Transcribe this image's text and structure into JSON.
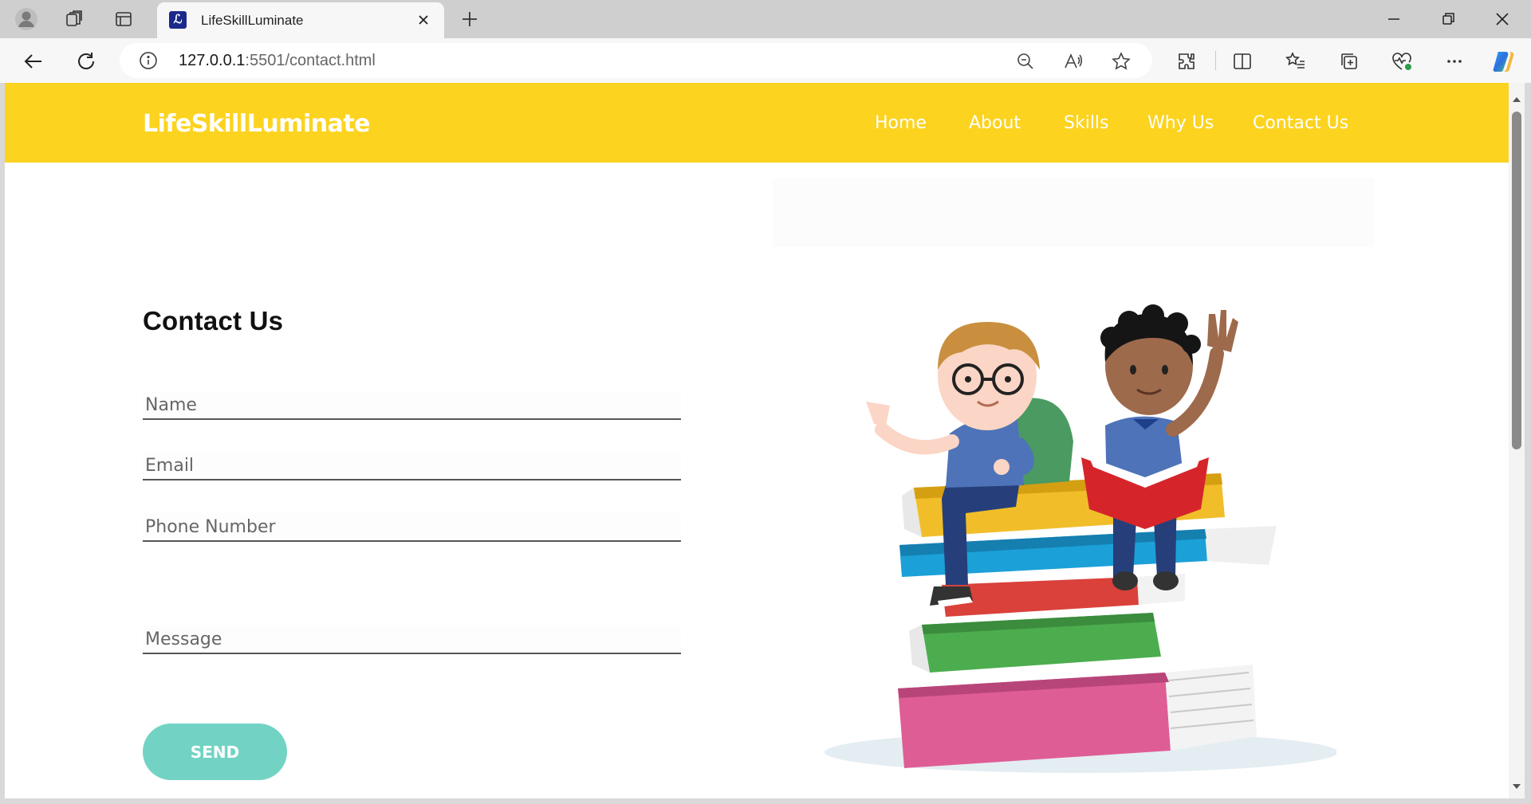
{
  "browser": {
    "tab_title": "LifeSkillLuminate",
    "url_host": "127.0.0.1",
    "url_rest": ":5501/contact.html"
  },
  "site": {
    "logo": "LifeSkillLuminate",
    "nav": [
      "Home",
      "About",
      "Skills",
      "Why Us",
      "Contact Us"
    ],
    "brand_color": "#fcd31f"
  },
  "contact": {
    "title": "Contact Us",
    "name_placeholder": "Name",
    "email_placeholder": "Email",
    "phone_placeholder": "Phone Number",
    "message_placeholder": "Message",
    "send_label": "SEND",
    "button_color": "#72d3c4"
  },
  "illustration": {
    "subject": "two-kids-sitting-on-books"
  }
}
